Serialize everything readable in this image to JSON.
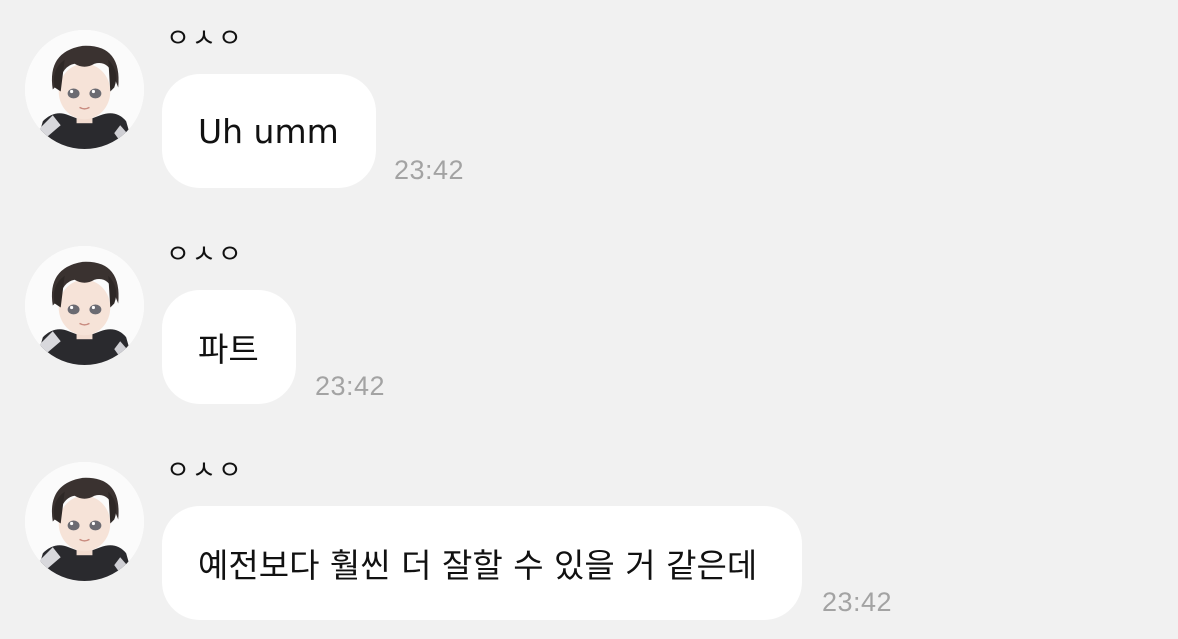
{
  "chat": {
    "messages": [
      {
        "sender": "ㅇㅅㅇ",
        "text": "Uh umm",
        "time": "23:42",
        "avatar": "profile-avatar-icon"
      },
      {
        "sender": "ㅇㅅㅇ",
        "text": "파트",
        "time": "23:42",
        "avatar": "profile-avatar-icon"
      },
      {
        "sender": "ㅇㅅㅇ",
        "text": "예전보다 훨씬 더 잘할 수 있을 거 같은데",
        "time": "23:42",
        "avatar": "profile-avatar-icon"
      }
    ]
  },
  "colors": {
    "background": "#f1f1f1",
    "bubble": "#ffffff",
    "timestamp": "#a3a3a3"
  }
}
